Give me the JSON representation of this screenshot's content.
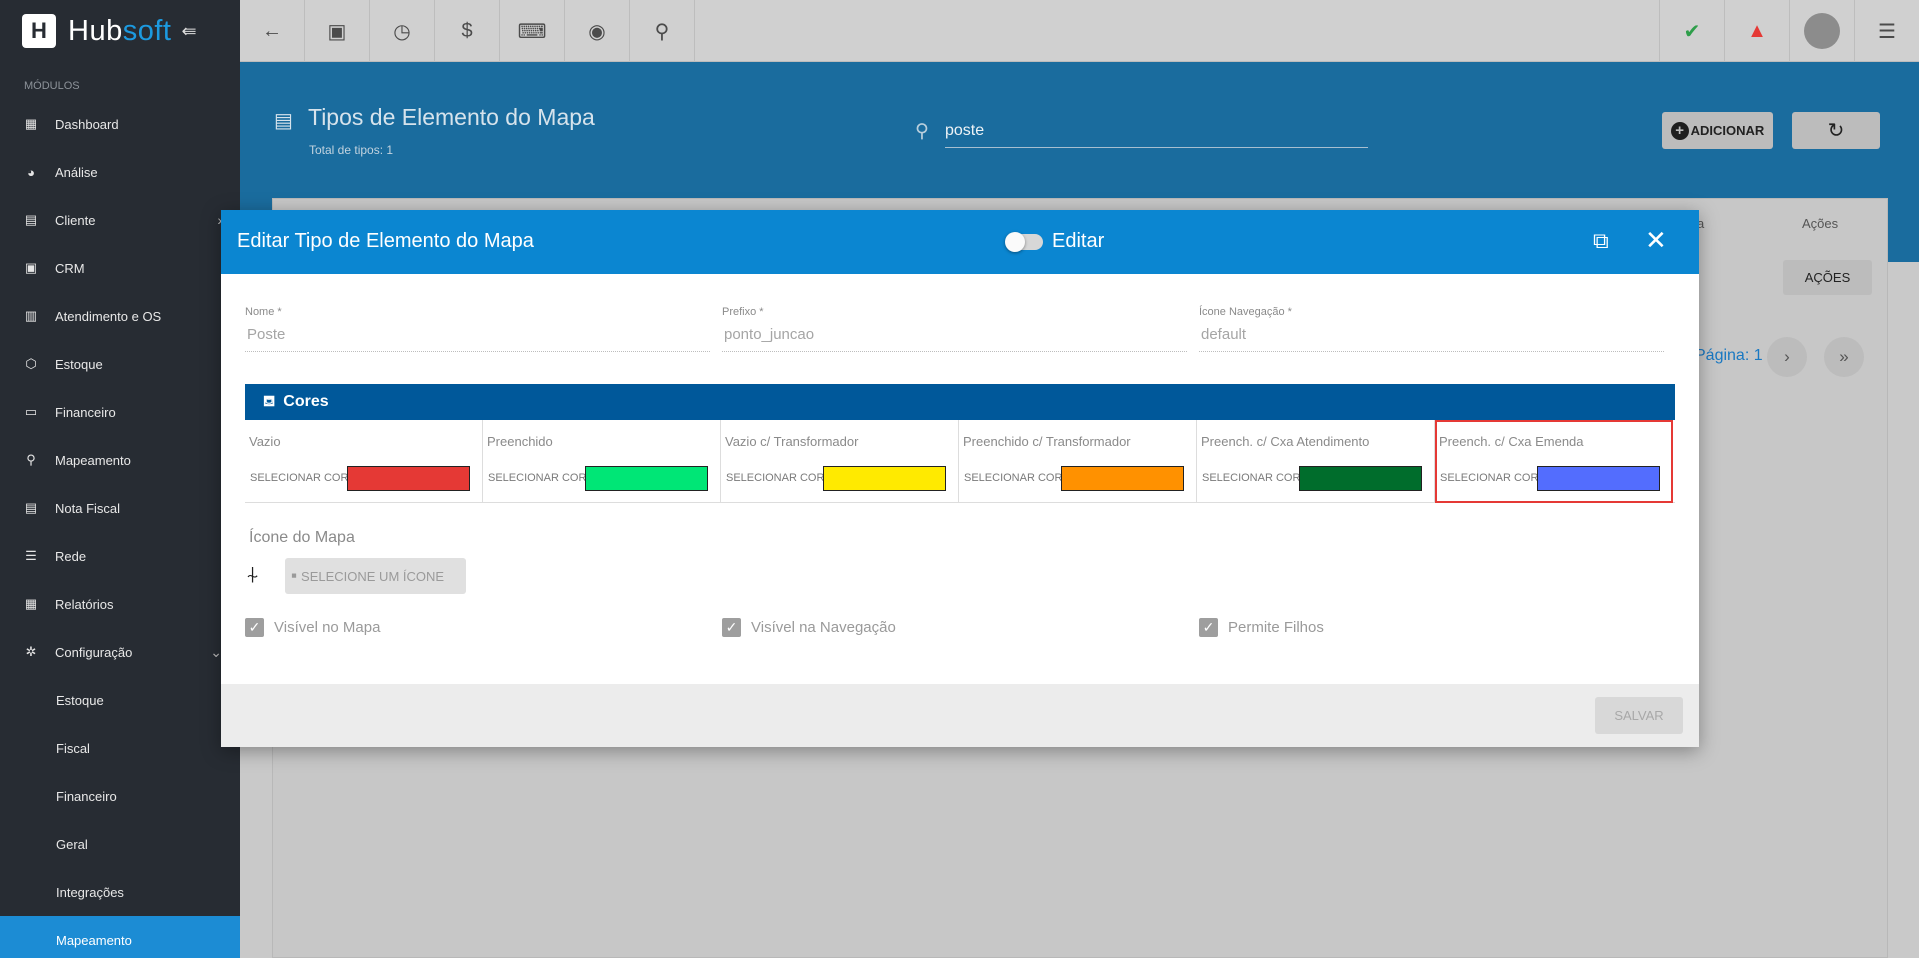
{
  "app": {
    "brand_part1": "Hub",
    "brand_part2": "soft"
  },
  "sidebar": {
    "modules_label": "MÓDULOS",
    "items": [
      {
        "label": "Dashboard",
        "icon": "dashboard-icon"
      },
      {
        "label": "Análise",
        "icon": "pie-chart-icon"
      },
      {
        "label": "Cliente",
        "icon": "contact-icon"
      },
      {
        "label": "CRM",
        "icon": "crm-icon"
      },
      {
        "label": "Atendimento e OS",
        "icon": "calendar-icon"
      },
      {
        "label": "Estoque",
        "icon": "box-icon"
      },
      {
        "label": "Financeiro",
        "icon": "money-icon"
      },
      {
        "label": "Mapeamento",
        "icon": "map-marker-icon"
      },
      {
        "label": "Nota Fiscal",
        "icon": "invoice-icon"
      },
      {
        "label": "Rede",
        "icon": "server-icon"
      },
      {
        "label": "Relatórios",
        "icon": "report-icon"
      },
      {
        "label": "Configuração",
        "icon": "gear-icon"
      }
    ],
    "sub_items": [
      {
        "label": "Estoque"
      },
      {
        "label": "Fiscal"
      },
      {
        "label": "Financeiro"
      },
      {
        "label": "Geral"
      },
      {
        "label": "Integrações"
      },
      {
        "label": "Mapeamento"
      }
    ]
  },
  "page": {
    "title": "Tipos de Elemento do Mapa",
    "total": "Total de tipos: 1",
    "search_value": "poste",
    "add_label": "ADICIONAR",
    "col_partial": "a",
    "col_actions": "Ações",
    "actions_btn": "AÇÕES",
    "page_label": "Página: 1"
  },
  "modal": {
    "title": "Editar Tipo de Elemento do Mapa",
    "edit_label": "Editar",
    "fields": {
      "nome_label": "Nome *",
      "nome_value": "Poste",
      "prefixo_label": "Prefixo *",
      "prefixo_value": "ponto_juncao",
      "icone_nav_label": "Ícone Navegação *",
      "icone_nav_value": "default"
    },
    "cores_title": "Cores",
    "select_color_label": "SELECIONAR COR",
    "colors": [
      {
        "label": "Vazio",
        "color": "#e53935"
      },
      {
        "label": "Preenchido",
        "color": "#00e676"
      },
      {
        "label": "Vazio c/ Transformador",
        "color": "#ffea00"
      },
      {
        "label": "Preenchido c/ Transformador",
        "color": "#ff9100"
      },
      {
        "label": "Preench. c/ Cxa Atendimento",
        "color": "#006d2c"
      },
      {
        "label": "Preench. c/ Cxa Emenda",
        "color": "#536dfe"
      }
    ],
    "map_icon_label": "Ícone do Mapa",
    "select_icon_label": "SELECIONE UM ÍCONE",
    "checks": [
      {
        "label": "Visível no Mapa",
        "checked": true
      },
      {
        "label": "Visível na Navegação",
        "checked": true
      },
      {
        "label": "Permite Filhos",
        "checked": true
      }
    ],
    "save_label": "SALVAR"
  }
}
